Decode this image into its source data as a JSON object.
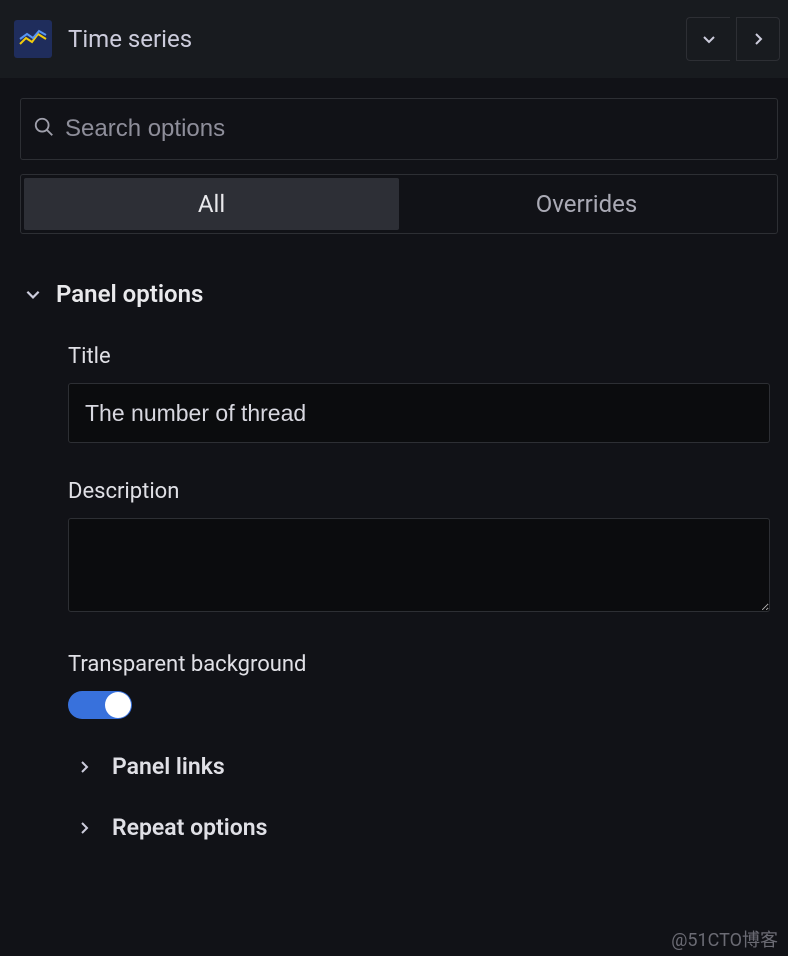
{
  "header": {
    "visualization_name": "Time series"
  },
  "search": {
    "placeholder": "Search options",
    "value": ""
  },
  "tabs": {
    "all": "All",
    "overrides": "Overrides",
    "active": "all"
  },
  "panel_options": {
    "section_title": "Panel options",
    "title": {
      "label": "Title",
      "value": "The number of thread"
    },
    "description": {
      "label": "Description",
      "value": ""
    },
    "transparent": {
      "label": "Transparent background",
      "enabled": true
    },
    "panel_links": {
      "label": "Panel links"
    },
    "repeat_options": {
      "label": "Repeat options"
    }
  },
  "watermark": "@51CTO博客"
}
